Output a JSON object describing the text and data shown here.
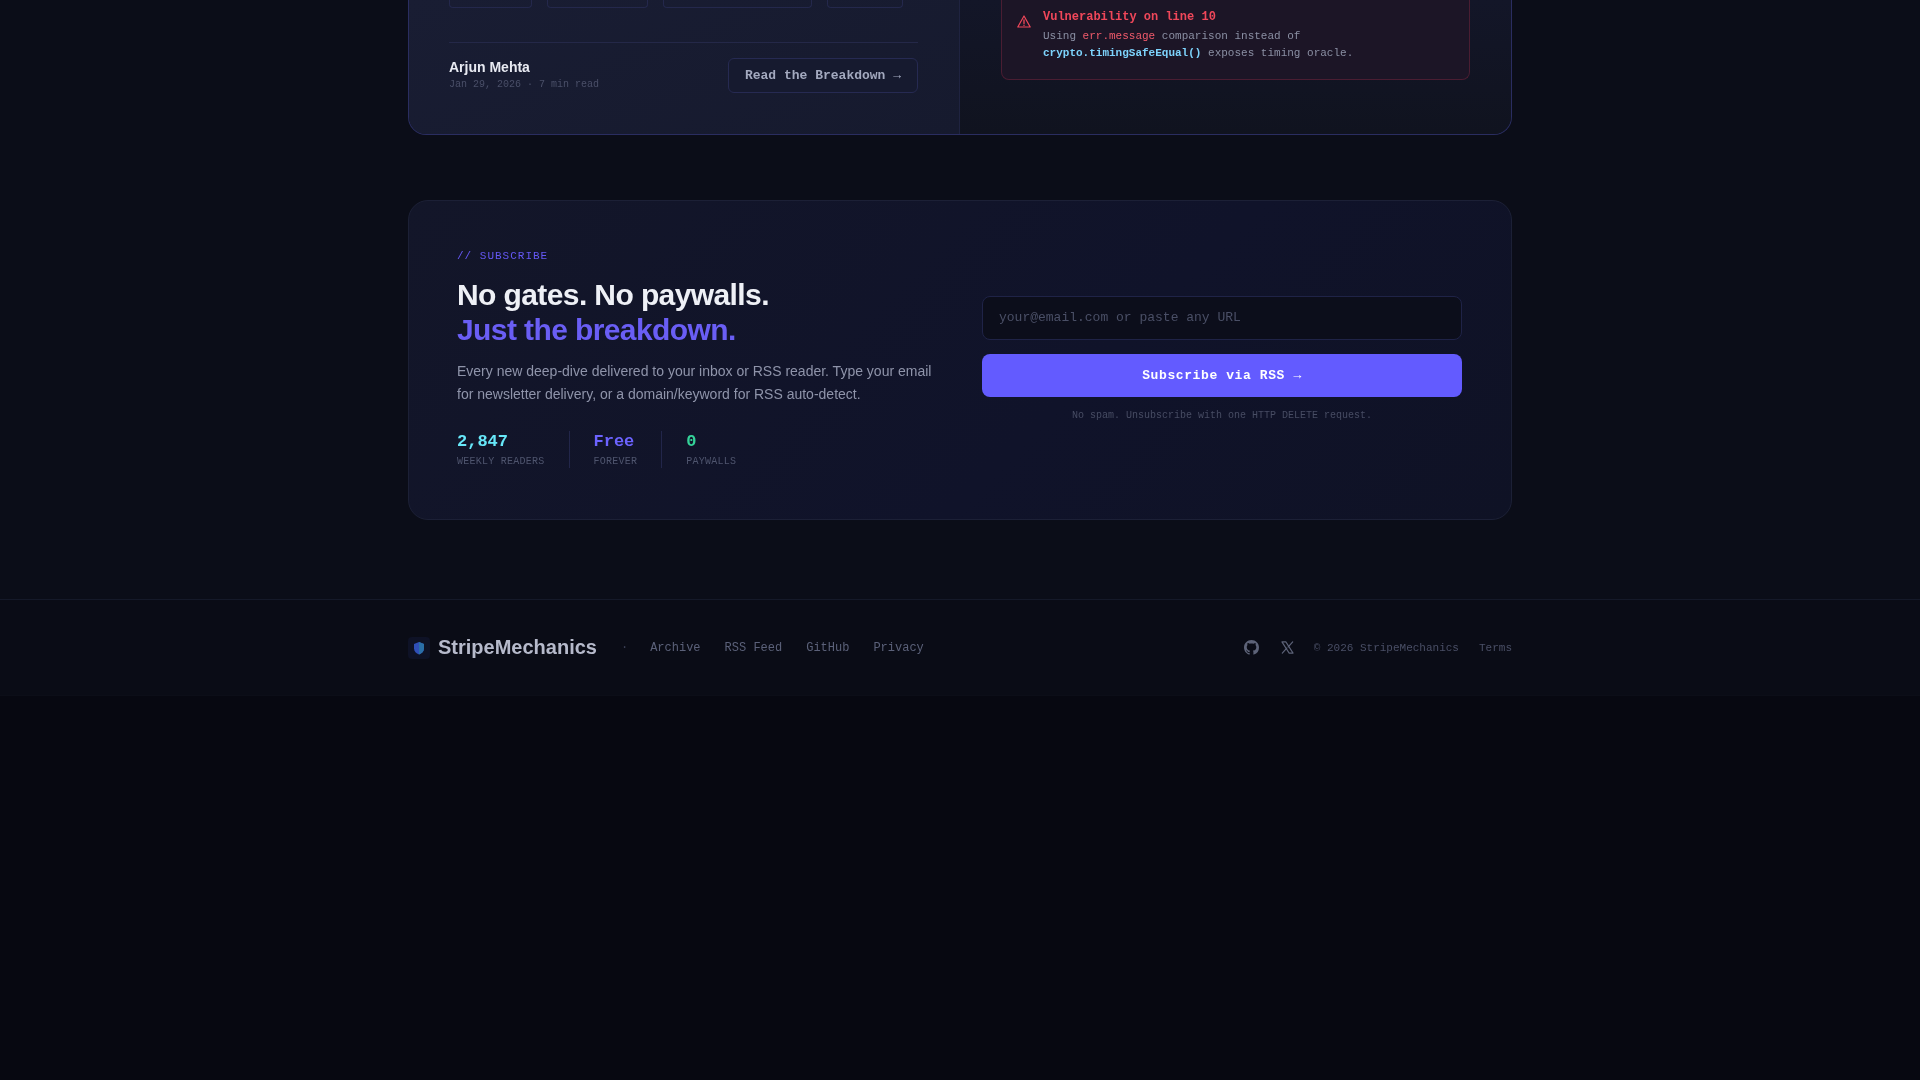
{
  "article_card": {
    "author": "Arjun Mehta",
    "meta": "Jan 29, 2026 · 7 min read",
    "read_button": "Read the Breakdown →",
    "alert": {
      "kind": "error",
      "title": "Vulnerability on line 10",
      "message": [
        {
          "kind": "text",
          "text": "Using "
        },
        {
          "kind": "error_code",
          "text": "err.message"
        },
        {
          "kind": "text",
          "text": " comparison instead of "
        },
        {
          "kind": "safe_code",
          "text": "crypto.timingSafeEqual()"
        },
        {
          "kind": "text",
          "text": " exposes timing oracle."
        }
      ]
    }
  },
  "subscribe": {
    "label": "// SUBSCRIBE",
    "title": "No gates. No paywalls.",
    "title_accent": "Just the breakdown.",
    "description": "Every new deep-dive delivered to your inbox or RSS reader. Type your email for newsletter delivery, or a domain/keyword for RSS auto-detect.",
    "stats": [
      {
        "value": "2,847",
        "label": "WEEKLY READERS",
        "color": "#67e8f9"
      },
      {
        "value": "Free",
        "label": "FOREVER",
        "color": "#6c63ff"
      },
      {
        "value": "0",
        "label": "PAYWALLS",
        "color": "#34d399"
      }
    ],
    "email_field": {
      "placeholder": "your@email.com or paste any URL"
    },
    "button": "Subscribe via RSS →",
    "note": "No spam. Unsubscribe with one HTTP DELETE request."
  },
  "footer": {
    "brand": "StripeMechanics",
    "separator": "·",
    "links": [
      "Archive",
      "RSS Feed",
      "GitHub",
      "Privacy"
    ],
    "social": [
      {
        "kind": "github"
      },
      {
        "kind": "x"
      }
    ],
    "copyright": "© 2026 StripeMechanics",
    "terms": "Terms"
  }
}
